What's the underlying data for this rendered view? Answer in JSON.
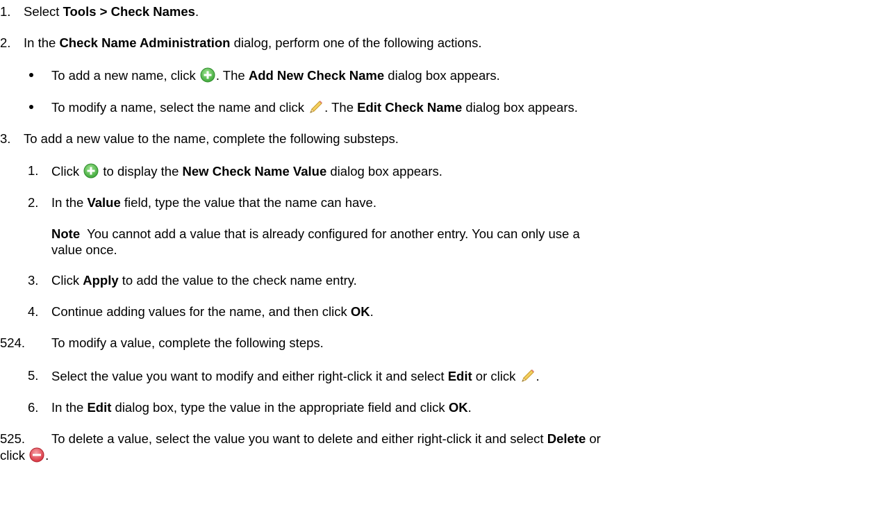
{
  "step1": {
    "num": "1.",
    "pre": "Select ",
    "bold": "Tools > Check Names",
    "post": "."
  },
  "step2": {
    "num": "2.",
    "pre": "In the ",
    "bold": "Check Name Administration",
    "post": " dialog, perform one of the following actions.",
    "bullets": [
      {
        "pre": "To add a new name, click ",
        "icon": "add-icon",
        "mid": ". The ",
        "bold": "Add New Check Name",
        "post": " dialog box appears."
      },
      {
        "pre": "To modify a name, select the name and click ",
        "icon": "edit-icon",
        "mid": ".  The ",
        "bold": "Edit Check Name",
        "post": " dialog box appears."
      }
    ]
  },
  "step3": {
    "num": "3.",
    "text": "To add a new value to the name, complete the following substeps.",
    "sub1": {
      "num": "1.",
      "pre": "Click ",
      "icon": "add-icon",
      "mid": " to display the ",
      "bold": "New Check Name Value",
      "post": " dialog box appears."
    },
    "sub2": {
      "num": "2.",
      "pre": "In the ",
      "bold": "Value",
      "post": " field, type the value that the name can have."
    },
    "note": {
      "label": "Note",
      "line1": "  You cannot add a value that is already configured for another entry. You can only use a",
      "line2": "value once."
    },
    "sub3": {
      "num": "3.",
      "pre": "Click ",
      "bold": "Apply",
      "post": " to add the value to the check name entry."
    },
    "sub4": {
      "num": "4.",
      "pre": "Continue adding values for the name, and then click ",
      "bold": "OK",
      "post": "."
    }
  },
  "step524": {
    "num": "524.",
    "text": "To modify a value, complete the following steps.",
    "sub5": {
      "num": "5.",
      "pre": "Select the value you want to modify and either right-click it and select ",
      "bold": "Edit",
      "mid": " or click ",
      "icon": "edit-icon",
      "post": "."
    },
    "sub6": {
      "num": "6.",
      "pre": "In the ",
      "bold": "Edit",
      "mid": " dialog box, type the value in the appropriate field and click ",
      "bold2": "OK",
      "post": "."
    }
  },
  "step525": {
    "num": "525.",
    "pre": "To delete a value, select the value you want to delete and either right-click it and select ",
    "bold": "Delete",
    "post": " or",
    "line2_pre": "click ",
    "icon": "delete-icon",
    "line2_post": "."
  },
  "colors": {
    "add_icon_green": "#4cb848",
    "edit_icon_yellow": "#f2c84b",
    "delete_icon_red": "#e8414d"
  }
}
